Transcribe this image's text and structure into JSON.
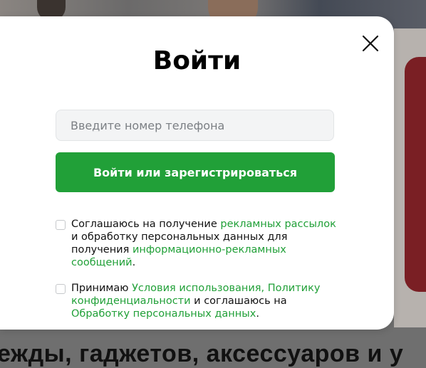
{
  "modal": {
    "title": "Войти",
    "phone_placeholder": "Введите номер телефона",
    "submit_label": "Войти или зарегистрироваться",
    "close_icon": "close-icon",
    "consent_marketing": {
      "text_1": "Соглашаюсь на получение ",
      "link_1": "рекламных рассылок",
      "text_2": " и обработку персональных данных для получения ",
      "link_2": "информационно-рекламных сообщений",
      "text_3": "."
    },
    "consent_terms": {
      "text_1": "Принимаю ",
      "link_1": "Условия использования, Политику конфиденциальности",
      "text_2": " и соглашаюсь на ",
      "link_2": "Обработку персональных данных",
      "text_3": "."
    }
  },
  "background": {
    "headline": "ежды, гаджетов, аксессуаров и у"
  },
  "colors": {
    "accent": "#21a038",
    "overlay": "#6f6f6f",
    "input_bg": "#f3f4f5"
  }
}
